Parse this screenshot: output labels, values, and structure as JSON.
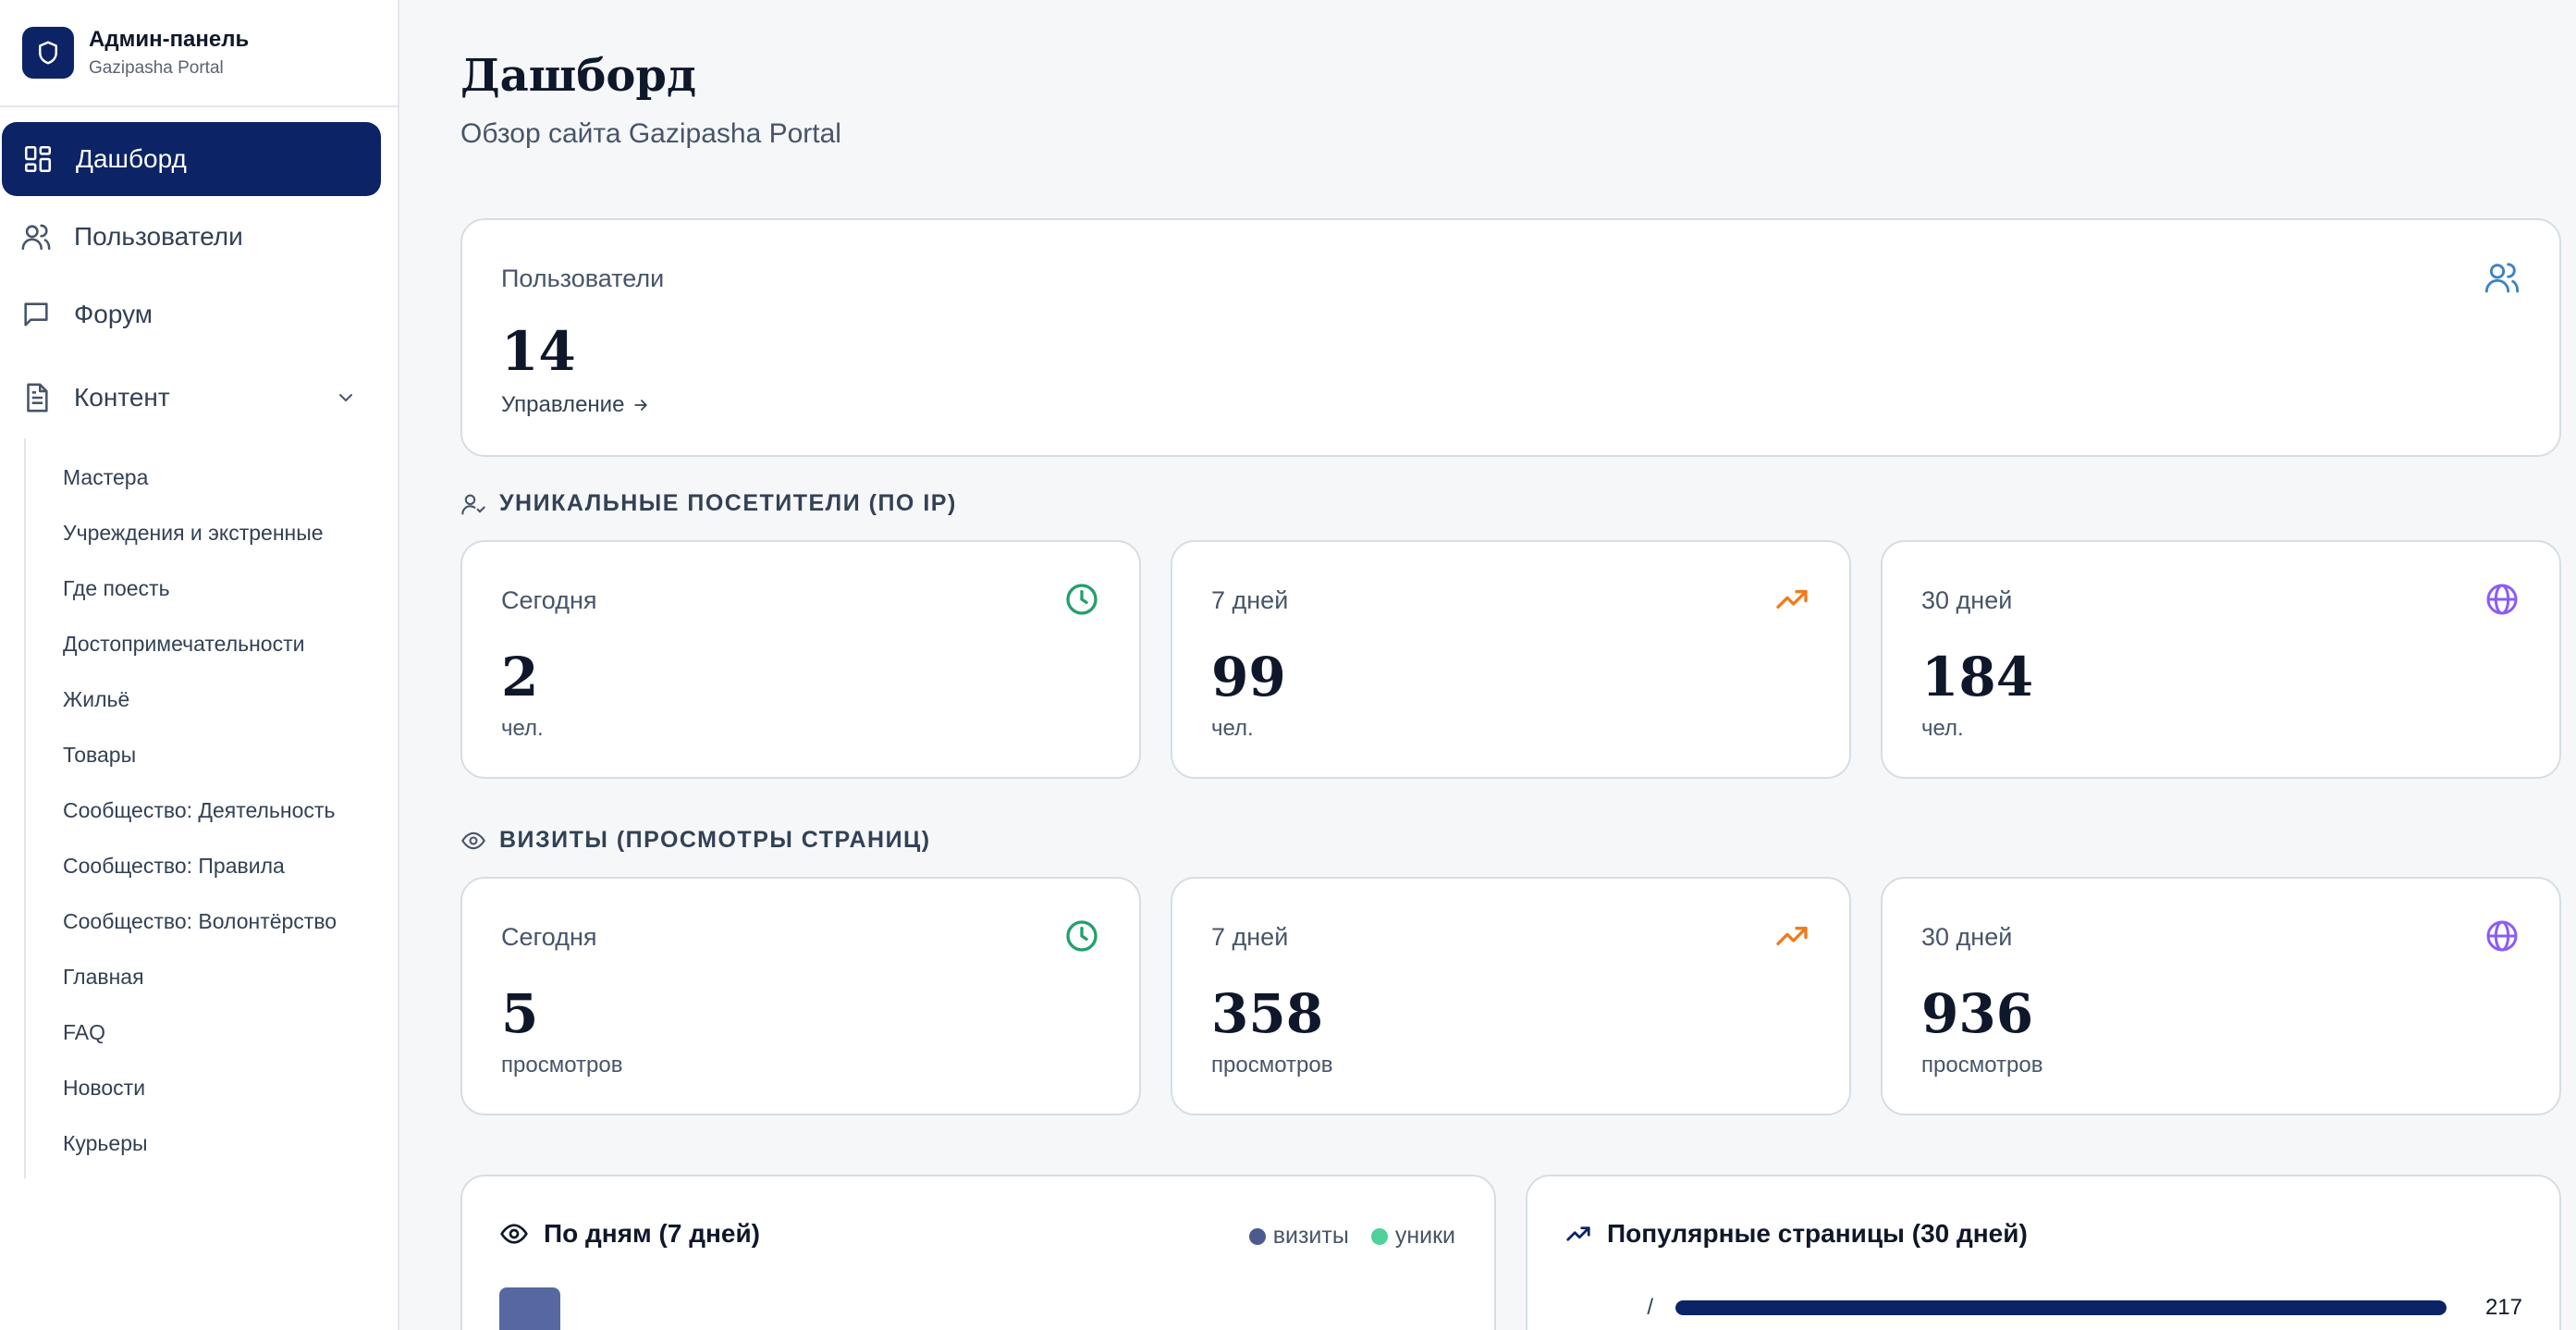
{
  "brand": {
    "title": "Админ-панель",
    "subtitle": "Gazipasha Portal"
  },
  "nav": {
    "items": [
      {
        "label": "Дашборд",
        "icon": "dashboard-icon",
        "active": true
      },
      {
        "label": "Пользователи",
        "icon": "users-icon"
      },
      {
        "label": "Форум",
        "icon": "chat-icon"
      },
      {
        "label": "Контент",
        "icon": "document-icon",
        "expanded": true
      }
    ],
    "content_items": [
      "Мастера",
      "Учреждения и экстренные",
      "Где поесть",
      "Достопримечательности",
      "Жильё",
      "Товары",
      "Сообщество: Деятельность",
      "Сообщество: Правила",
      "Сообщество: Волонтёрство",
      "Главная",
      "FAQ",
      "Новости",
      "Курьеры"
    ]
  },
  "page": {
    "title": "Дашборд",
    "subtitle": "Обзор сайта Gazipasha Portal"
  },
  "users_card": {
    "label": "Пользователи",
    "value": "14",
    "link": "Управление"
  },
  "unique_section": {
    "title": "УНИКАЛЬНЫЕ ПОСЕТИТЕЛИ (ПО IP)",
    "cards": [
      {
        "label": "Сегодня",
        "value": "2",
        "unit": "чел.",
        "icon": "clock-icon"
      },
      {
        "label": "7 дней",
        "value": "99",
        "unit": "чел.",
        "icon": "trending-up-icon"
      },
      {
        "label": "30 дней",
        "value": "184",
        "unit": "чел.",
        "icon": "globe-icon"
      }
    ]
  },
  "visits_section": {
    "title": "ВИЗИТЫ (ПРОСМОТРЫ СТРАНИЦ)",
    "cards": [
      {
        "label": "Сегодня",
        "value": "5",
        "unit": "просмотров",
        "icon": "clock-icon"
      },
      {
        "label": "7 дней",
        "value": "358",
        "unit": "просмотров",
        "icon": "trending-up-icon"
      },
      {
        "label": "30 дней",
        "value": "936",
        "unit": "просмотров",
        "icon": "globe-icon"
      }
    ]
  },
  "daily_panel": {
    "title": "По дням (7 дней)",
    "legend_visits": "визиты",
    "legend_unique": "уники"
  },
  "popular_panel": {
    "title": "Популярные страницы (30 дней)",
    "rows": [
      {
        "path": "/",
        "count": "217",
        "share": 1.0
      }
    ]
  },
  "colors": {
    "accent": "#0c2366",
    "green": "#22a06b",
    "orange": "#f07b1d",
    "purple": "#8b5cf6",
    "blue": "#3b82c4",
    "visits_dot": "#4b5b8f",
    "unique_dot": "#4fd19b"
  }
}
